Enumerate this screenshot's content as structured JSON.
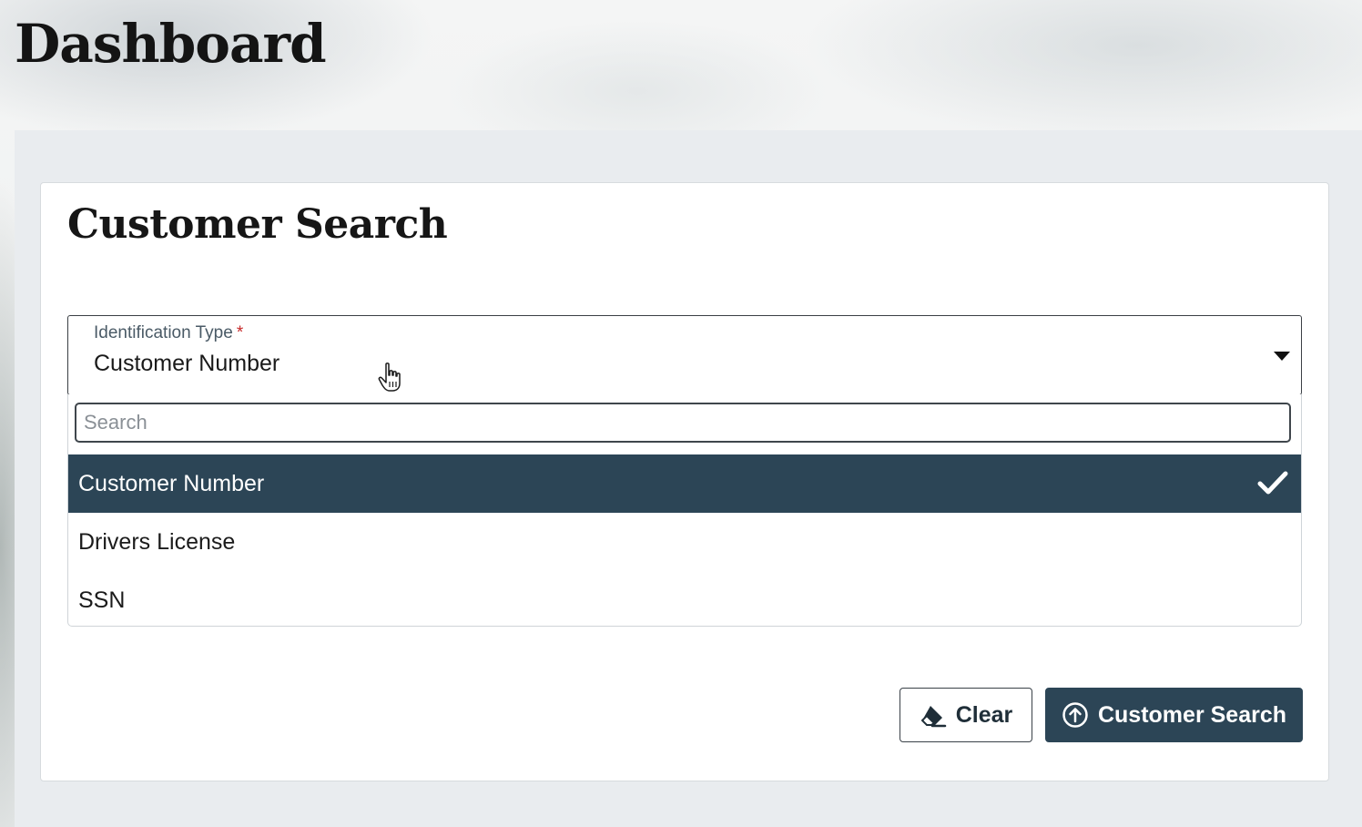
{
  "page": {
    "title": "Dashboard"
  },
  "card": {
    "title": "Customer Search"
  },
  "identification_field": {
    "label": "Identification Type",
    "required_marker": "*",
    "value": "Customer Number",
    "icon": "caret-down-icon"
  },
  "dropdown": {
    "search_placeholder": "Search",
    "search_value": "",
    "options": [
      {
        "label": "Customer Number",
        "selected": true
      },
      {
        "label": "Drivers License",
        "selected": false
      },
      {
        "label": "SSN",
        "selected": false
      }
    ],
    "selected_icon": "checkmark-icon"
  },
  "buttons": {
    "clear_label": "Clear",
    "clear_icon": "eraser-icon",
    "search_label": "Customer Search",
    "search_icon": "arrow-up-circle-icon"
  },
  "colors": {
    "primary": "#2c4556",
    "required": "#c62828",
    "content_background": "#e9ecef"
  }
}
